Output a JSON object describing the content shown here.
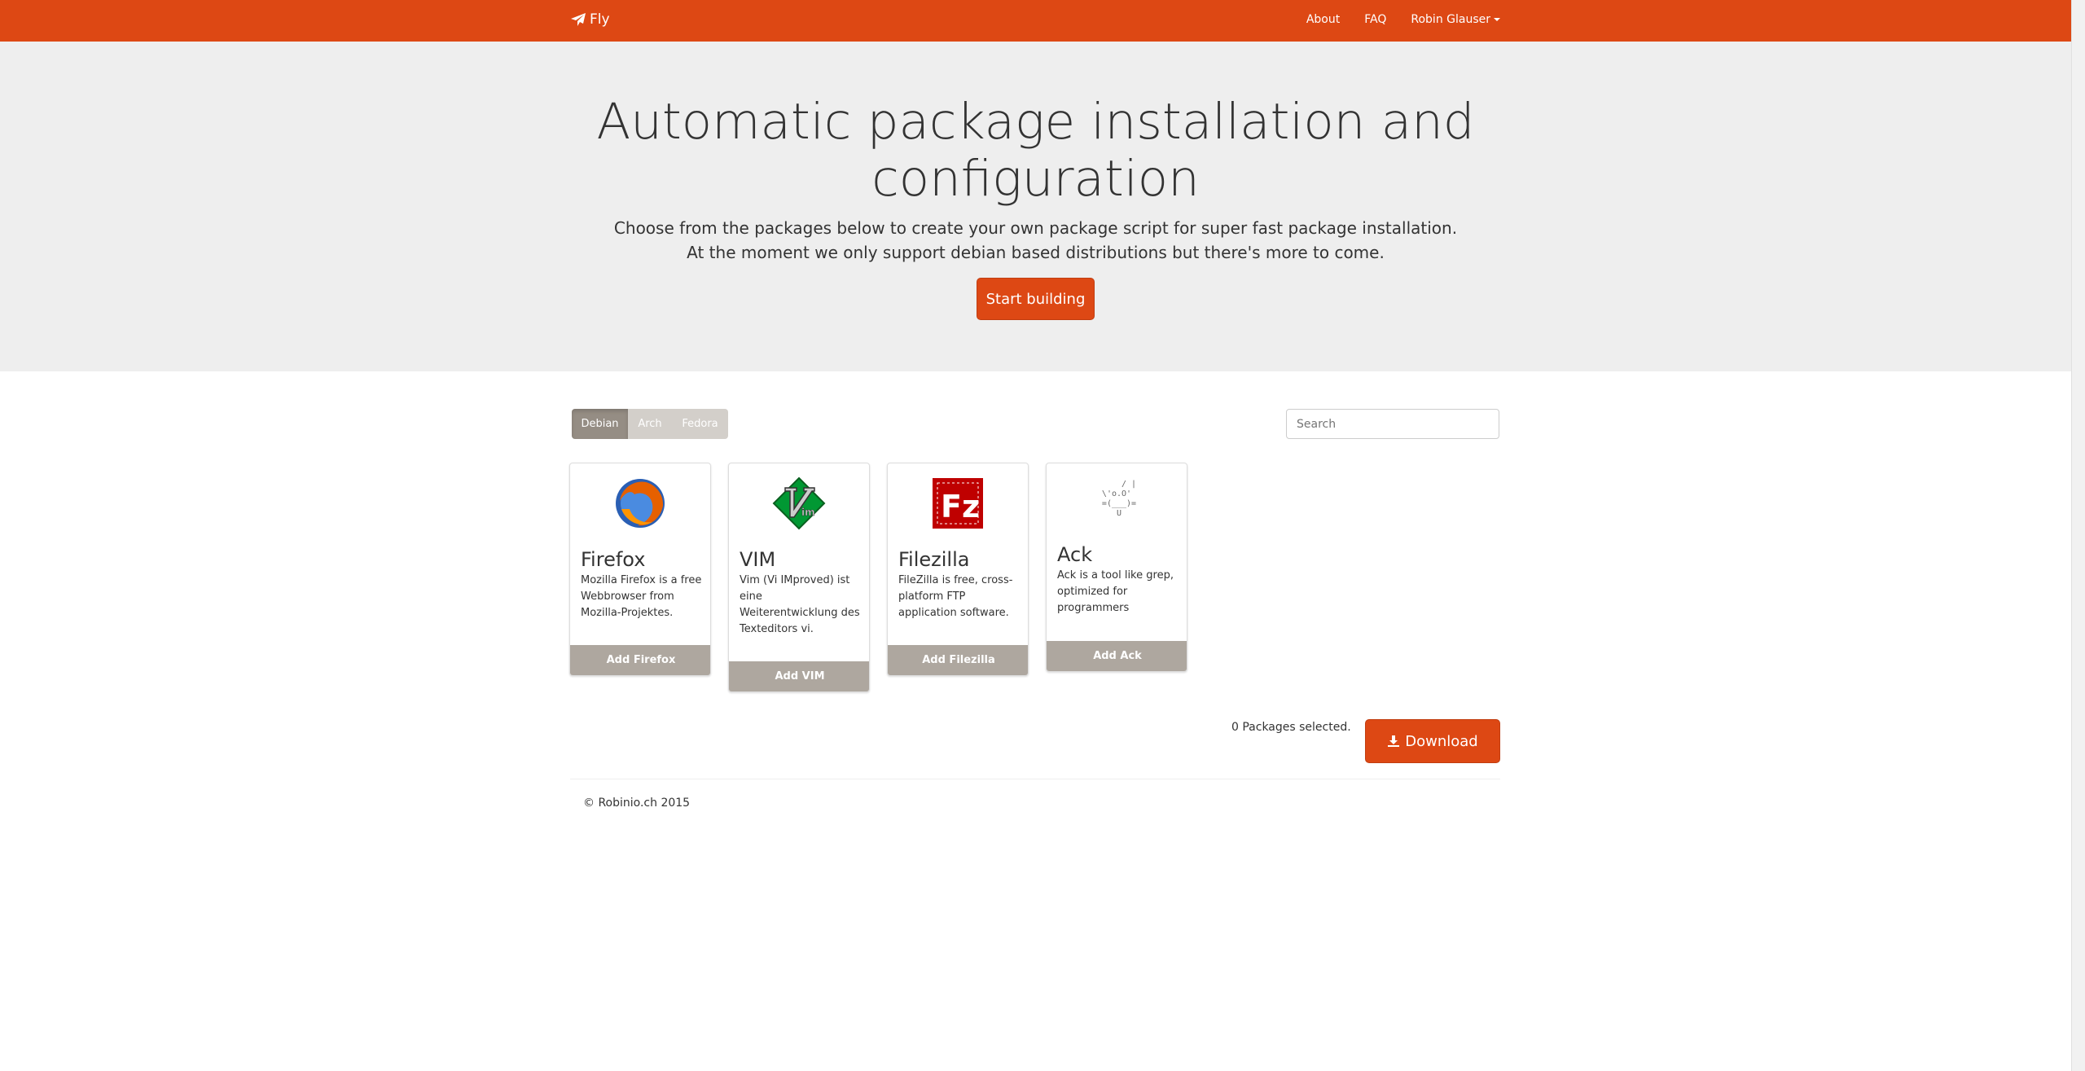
{
  "navbar": {
    "brand": "Fly",
    "links": [
      "About",
      "FAQ"
    ],
    "user": "Robin Glauser"
  },
  "hero": {
    "title_line1": "Automatic package installation and",
    "title_line2": "configuration",
    "lead_line1": "Choose from the packages below to create your own package script for super fast package installation.",
    "lead_line2": "At the moment we only support debian based distributions but there's more to come.",
    "cta": "Start building"
  },
  "distro_tabs": [
    "Debian",
    "Arch",
    "Fedora"
  ],
  "search": {
    "placeholder": "Search"
  },
  "packages": [
    {
      "name": "Firefox",
      "desc": "Mozilla Firefox is a free Webbrowser from Mozilla-Projektes.",
      "button": "Add Firefox",
      "icon": "firefox-icon"
    },
    {
      "name": "VIM",
      "desc": "Vim (Vi IMproved) ist eine Weiterentwicklung des Texteditors vi.",
      "button": "Add VIM",
      "icon": "vim-icon"
    },
    {
      "name": "Filezilla",
      "desc": "FileZilla is free, cross-platform FTP application software.",
      "button": "Add Filezilla",
      "icon": "filezilla-icon"
    },
    {
      "name": "Ack",
      "desc": "Ack is a tool like grep, optimized for programmers",
      "button": "Add Ack",
      "icon": "ack-icon"
    }
  ],
  "status": {
    "selected": "0 Packages selected."
  },
  "download": {
    "label": "Download"
  },
  "footer": {
    "text": "© Robinio.ch 2015"
  },
  "colors": {
    "accent": "#dd4814",
    "tab": "#aea79f",
    "hero_bg": "#eeeeee"
  }
}
